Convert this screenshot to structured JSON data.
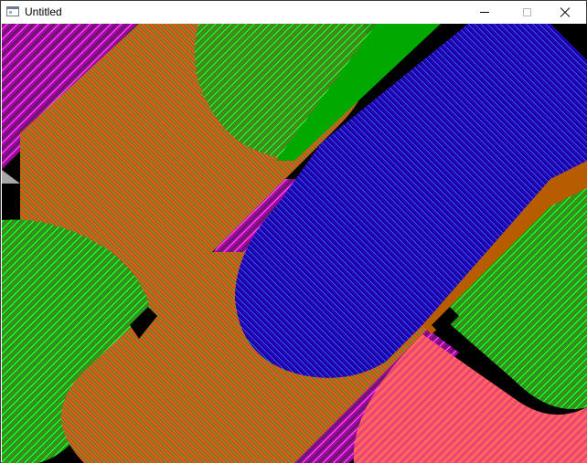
{
  "window": {
    "title": "Untitled",
    "controls": {
      "minimize": "minimize-icon",
      "maximize": "maximize-icon",
      "close": "close-icon"
    }
  },
  "canvas": {
    "description_colors": {
      "background": "#000000",
      "orange": "#b85c00",
      "green": "#00a800",
      "magenta": "#a800a8",
      "blue": "#0000a8",
      "salmon": "#ff5555",
      "gray": "#a8a8a8"
    }
  }
}
